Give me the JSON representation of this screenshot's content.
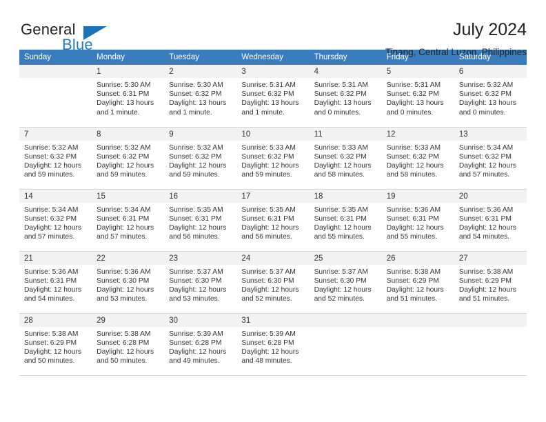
{
  "brand": {
    "name_top": "General",
    "name_bottom": "Blue",
    "triangle_color": "#1a72b8",
    "text_color": "#231f20",
    "blue_color": "#1f7dc4"
  },
  "header": {
    "title": "July 2024",
    "subtitle": "Tinang, Central Luzon, Philippines"
  },
  "theme": {
    "header_row_bg": "#3a7dbf",
    "daynum_bg": "#f2f2f2",
    "grid_line": "#d4d4d4"
  },
  "weekday_headers": [
    "Sunday",
    "Monday",
    "Tuesday",
    "Wednesday",
    "Thursday",
    "Friday",
    "Saturday"
  ],
  "weeks": [
    [
      {
        "day": "",
        "blank": true,
        "sunrise": "",
        "sunset": "",
        "daylight_1": "",
        "daylight_2": ""
      },
      {
        "day": "1",
        "sunrise": "Sunrise: 5:30 AM",
        "sunset": "Sunset: 6:31 PM",
        "daylight_1": "Daylight: 13 hours",
        "daylight_2": "and 1 minute."
      },
      {
        "day": "2",
        "sunrise": "Sunrise: 5:30 AM",
        "sunset": "Sunset: 6:32 PM",
        "daylight_1": "Daylight: 13 hours",
        "daylight_2": "and 1 minute."
      },
      {
        "day": "3",
        "sunrise": "Sunrise: 5:31 AM",
        "sunset": "Sunset: 6:32 PM",
        "daylight_1": "Daylight: 13 hours",
        "daylight_2": "and 1 minute."
      },
      {
        "day": "4",
        "sunrise": "Sunrise: 5:31 AM",
        "sunset": "Sunset: 6:32 PM",
        "daylight_1": "Daylight: 13 hours",
        "daylight_2": "and 0 minutes."
      },
      {
        "day": "5",
        "sunrise": "Sunrise: 5:31 AM",
        "sunset": "Sunset: 6:32 PM",
        "daylight_1": "Daylight: 13 hours",
        "daylight_2": "and 0 minutes."
      },
      {
        "day": "6",
        "sunrise": "Sunrise: 5:32 AM",
        "sunset": "Sunset: 6:32 PM",
        "daylight_1": "Daylight: 13 hours",
        "daylight_2": "and 0 minutes."
      }
    ],
    [
      {
        "day": "7",
        "sunrise": "Sunrise: 5:32 AM",
        "sunset": "Sunset: 6:32 PM",
        "daylight_1": "Daylight: 12 hours",
        "daylight_2": "and 59 minutes."
      },
      {
        "day": "8",
        "sunrise": "Sunrise: 5:32 AM",
        "sunset": "Sunset: 6:32 PM",
        "daylight_1": "Daylight: 12 hours",
        "daylight_2": "and 59 minutes."
      },
      {
        "day": "9",
        "sunrise": "Sunrise: 5:32 AM",
        "sunset": "Sunset: 6:32 PM",
        "daylight_1": "Daylight: 12 hours",
        "daylight_2": "and 59 minutes."
      },
      {
        "day": "10",
        "sunrise": "Sunrise: 5:33 AM",
        "sunset": "Sunset: 6:32 PM",
        "daylight_1": "Daylight: 12 hours",
        "daylight_2": "and 59 minutes."
      },
      {
        "day": "11",
        "sunrise": "Sunrise: 5:33 AM",
        "sunset": "Sunset: 6:32 PM",
        "daylight_1": "Daylight: 12 hours",
        "daylight_2": "and 58 minutes."
      },
      {
        "day": "12",
        "sunrise": "Sunrise: 5:33 AM",
        "sunset": "Sunset: 6:32 PM",
        "daylight_1": "Daylight: 12 hours",
        "daylight_2": "and 58 minutes."
      },
      {
        "day": "13",
        "sunrise": "Sunrise: 5:34 AM",
        "sunset": "Sunset: 6:32 PM",
        "daylight_1": "Daylight: 12 hours",
        "daylight_2": "and 57 minutes."
      }
    ],
    [
      {
        "day": "14",
        "sunrise": "Sunrise: 5:34 AM",
        "sunset": "Sunset: 6:32 PM",
        "daylight_1": "Daylight: 12 hours",
        "daylight_2": "and 57 minutes."
      },
      {
        "day": "15",
        "sunrise": "Sunrise: 5:34 AM",
        "sunset": "Sunset: 6:31 PM",
        "daylight_1": "Daylight: 12 hours",
        "daylight_2": "and 57 minutes."
      },
      {
        "day": "16",
        "sunrise": "Sunrise: 5:35 AM",
        "sunset": "Sunset: 6:31 PM",
        "daylight_1": "Daylight: 12 hours",
        "daylight_2": "and 56 minutes."
      },
      {
        "day": "17",
        "sunrise": "Sunrise: 5:35 AM",
        "sunset": "Sunset: 6:31 PM",
        "daylight_1": "Daylight: 12 hours",
        "daylight_2": "and 56 minutes."
      },
      {
        "day": "18",
        "sunrise": "Sunrise: 5:35 AM",
        "sunset": "Sunset: 6:31 PM",
        "daylight_1": "Daylight: 12 hours",
        "daylight_2": "and 55 minutes."
      },
      {
        "day": "19",
        "sunrise": "Sunrise: 5:36 AM",
        "sunset": "Sunset: 6:31 PM",
        "daylight_1": "Daylight: 12 hours",
        "daylight_2": "and 55 minutes."
      },
      {
        "day": "20",
        "sunrise": "Sunrise: 5:36 AM",
        "sunset": "Sunset: 6:31 PM",
        "daylight_1": "Daylight: 12 hours",
        "daylight_2": "and 54 minutes."
      }
    ],
    [
      {
        "day": "21",
        "sunrise": "Sunrise: 5:36 AM",
        "sunset": "Sunset: 6:31 PM",
        "daylight_1": "Daylight: 12 hours",
        "daylight_2": "and 54 minutes."
      },
      {
        "day": "22",
        "sunrise": "Sunrise: 5:36 AM",
        "sunset": "Sunset: 6:30 PM",
        "daylight_1": "Daylight: 12 hours",
        "daylight_2": "and 53 minutes."
      },
      {
        "day": "23",
        "sunrise": "Sunrise: 5:37 AM",
        "sunset": "Sunset: 6:30 PM",
        "daylight_1": "Daylight: 12 hours",
        "daylight_2": "and 53 minutes."
      },
      {
        "day": "24",
        "sunrise": "Sunrise: 5:37 AM",
        "sunset": "Sunset: 6:30 PM",
        "daylight_1": "Daylight: 12 hours",
        "daylight_2": "and 52 minutes."
      },
      {
        "day": "25",
        "sunrise": "Sunrise: 5:37 AM",
        "sunset": "Sunset: 6:30 PM",
        "daylight_1": "Daylight: 12 hours",
        "daylight_2": "and 52 minutes."
      },
      {
        "day": "26",
        "sunrise": "Sunrise: 5:38 AM",
        "sunset": "Sunset: 6:29 PM",
        "daylight_1": "Daylight: 12 hours",
        "daylight_2": "and 51 minutes."
      },
      {
        "day": "27",
        "sunrise": "Sunrise: 5:38 AM",
        "sunset": "Sunset: 6:29 PM",
        "daylight_1": "Daylight: 12 hours",
        "daylight_2": "and 51 minutes."
      }
    ],
    [
      {
        "day": "28",
        "sunrise": "Sunrise: 5:38 AM",
        "sunset": "Sunset: 6:29 PM",
        "daylight_1": "Daylight: 12 hours",
        "daylight_2": "and 50 minutes."
      },
      {
        "day": "29",
        "sunrise": "Sunrise: 5:38 AM",
        "sunset": "Sunset: 6:28 PM",
        "daylight_1": "Daylight: 12 hours",
        "daylight_2": "and 50 minutes."
      },
      {
        "day": "30",
        "sunrise": "Sunrise: 5:39 AM",
        "sunset": "Sunset: 6:28 PM",
        "daylight_1": "Daylight: 12 hours",
        "daylight_2": "and 49 minutes."
      },
      {
        "day": "31",
        "sunrise": "Sunrise: 5:39 AM",
        "sunset": "Sunset: 6:28 PM",
        "daylight_1": "Daylight: 12 hours",
        "daylight_2": "and 48 minutes."
      },
      {
        "day": "",
        "blank": true,
        "sunrise": "",
        "sunset": "",
        "daylight_1": "",
        "daylight_2": ""
      },
      {
        "day": "",
        "blank": true,
        "sunrise": "",
        "sunset": "",
        "daylight_1": "",
        "daylight_2": ""
      },
      {
        "day": "",
        "blank": true,
        "sunrise": "",
        "sunset": "",
        "daylight_1": "",
        "daylight_2": ""
      }
    ]
  ]
}
